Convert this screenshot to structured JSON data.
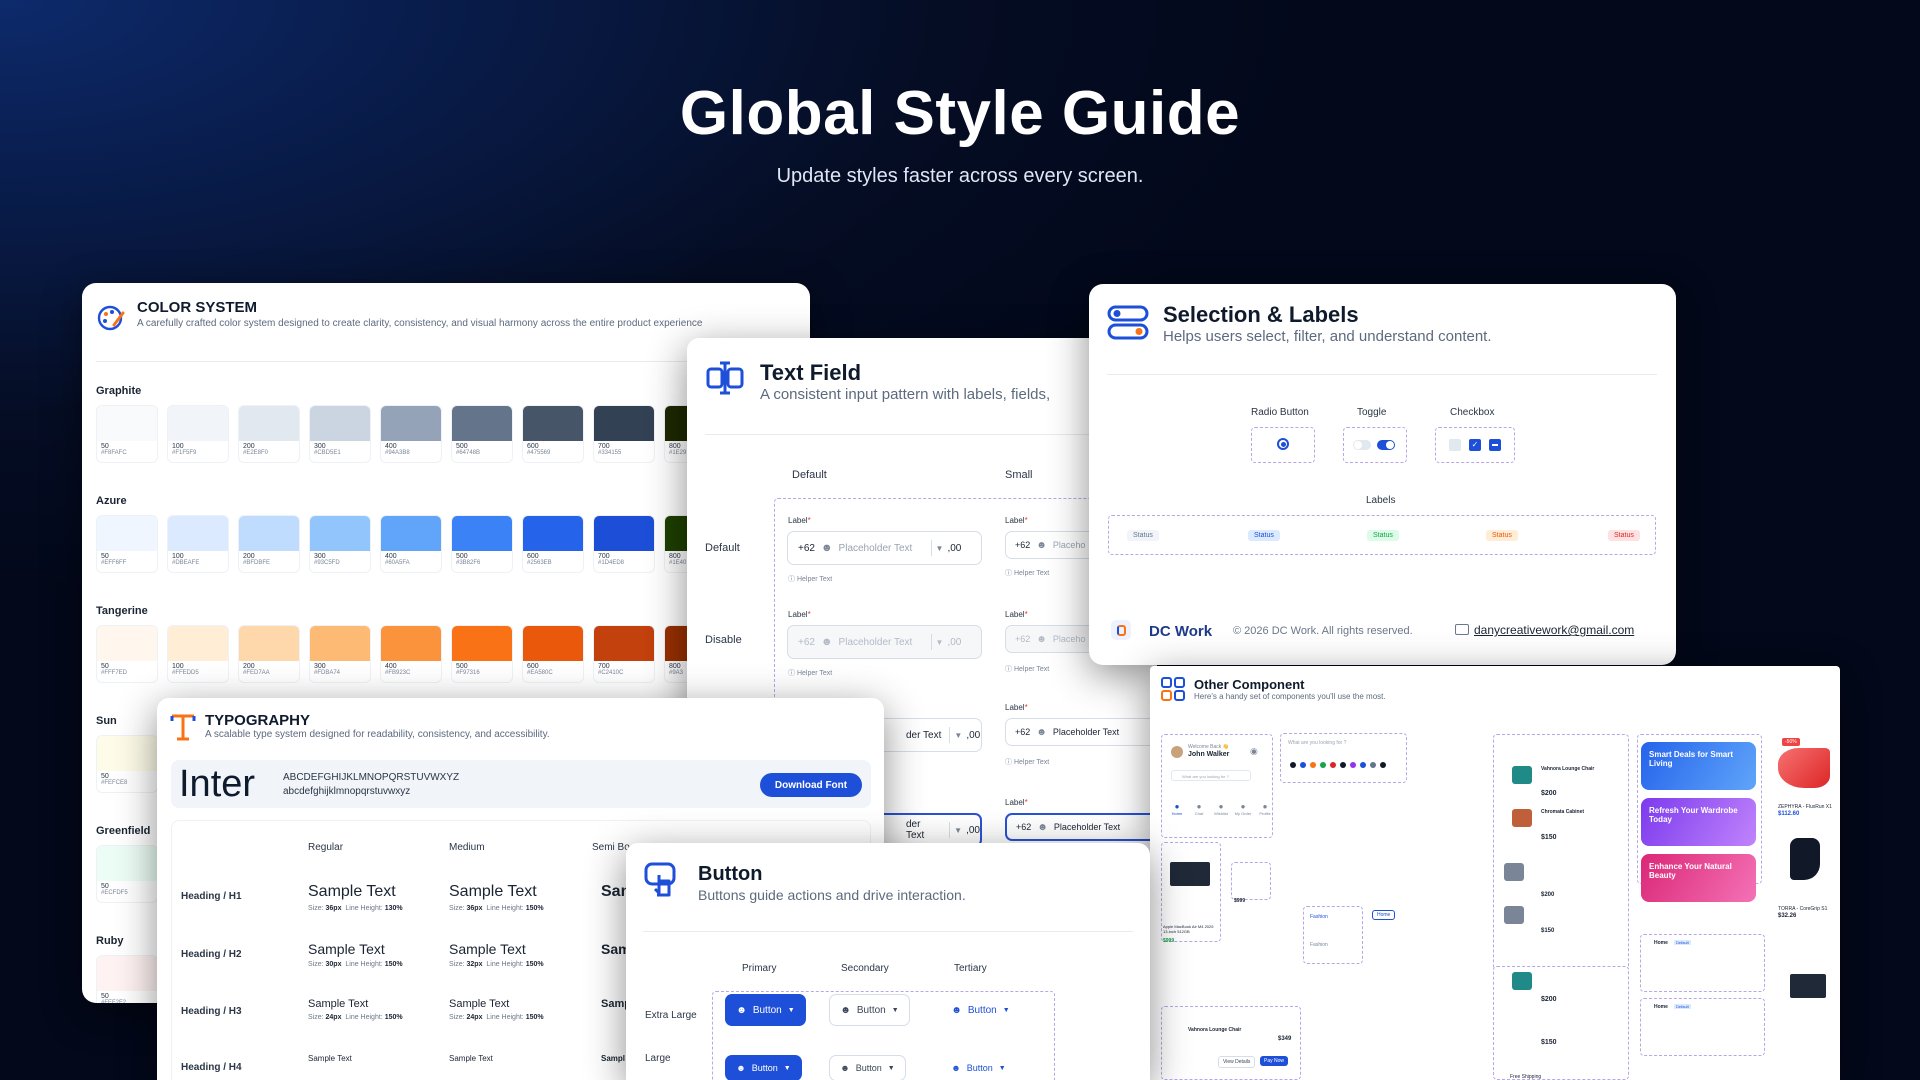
{
  "hero": {
    "title": "Global Style Guide",
    "subtitle": "Update styles faster across every screen."
  },
  "color_system": {
    "title": "COLOR SYSTEM",
    "subtitle": "A carefully crafted color system designed to create clarity, consistency, and visual harmony across the entire product experience",
    "palettes": [
      {
        "name": "Graphite",
        "swatches": [
          {
            "step": "50",
            "hex": "#F8FAFC"
          },
          {
            "step": "100",
            "hex": "#F1F5F9"
          },
          {
            "step": "200",
            "hex": "#E2E8F0"
          },
          {
            "step": "300",
            "hex": "#CBD5E1"
          },
          {
            "step": "400",
            "hex": "#94A3B8"
          },
          {
            "step": "500",
            "hex": "#64748B"
          },
          {
            "step": "600",
            "hex": "#475569"
          },
          {
            "step": "700",
            "hex": "#334155"
          },
          {
            "step": "800",
            "hex": "#1E29"
          }
        ]
      },
      {
        "name": "Azure",
        "swatches": [
          {
            "step": "50",
            "hex": "#EFF6FF"
          },
          {
            "step": "100",
            "hex": "#DBEAFE"
          },
          {
            "step": "200",
            "hex": "#BFDBFE"
          },
          {
            "step": "300",
            "hex": "#93C5FD"
          },
          {
            "step": "400",
            "hex": "#60A5FA"
          },
          {
            "step": "500",
            "hex": "#3B82F6"
          },
          {
            "step": "600",
            "hex": "#2563EB"
          },
          {
            "step": "700",
            "hex": "#1D4ED8"
          },
          {
            "step": "800",
            "hex": "#1E40"
          }
        ]
      },
      {
        "name": "Tangerine",
        "swatches": [
          {
            "step": "50",
            "hex": "#FFF7ED"
          },
          {
            "step": "100",
            "hex": "#FFEDD5"
          },
          {
            "step": "200",
            "hex": "#FED7AA"
          },
          {
            "step": "300",
            "hex": "#FDBA74"
          },
          {
            "step": "400",
            "hex": "#FB923C"
          },
          {
            "step": "500",
            "hex": "#F97316"
          },
          {
            "step": "600",
            "hex": "#EA580C"
          },
          {
            "step": "700",
            "hex": "#C2410C"
          },
          {
            "step": "800",
            "hex": "#9A3"
          }
        ]
      },
      {
        "name": "Sun",
        "swatches": [
          {
            "step": "50",
            "hex": "#FEFCE8"
          }
        ]
      },
      {
        "name": "Greenfield",
        "swatches": [
          {
            "step": "50",
            "hex": "#ECFDF5"
          }
        ]
      },
      {
        "name": "Ruby",
        "swatches": [
          {
            "step": "50",
            "hex": "#FEF2F2"
          }
        ]
      }
    ]
  },
  "text_field": {
    "title": "Text Field",
    "subtitle": "A consistent input pattern with labels, fields,",
    "col_default": "Default",
    "col_small": "Small",
    "row_default": "Default",
    "row_disable": "Disable",
    "label": "Label",
    "required": "*",
    "prefix": "+62",
    "placeholder": "Placeholder Text",
    "placeholder_short": "Placeho",
    "suffix": ",00",
    "helper": "Helper Text",
    "partial_placeholder": "der Text"
  },
  "selection": {
    "title": "Selection & Labels",
    "subtitle": "Helps users select, filter, and understand content.",
    "radio": "Radio Button",
    "toggle": "Toggle",
    "checkbox": "Checkbox",
    "labels_title": "Labels",
    "statuses": [
      {
        "text": "Status",
        "bg": "#f1f5f9",
        "fg": "#64748b"
      },
      {
        "text": "Status",
        "bg": "#dbeafe",
        "fg": "#1d4ed8"
      },
      {
        "text": "Status",
        "bg": "#dcfce7",
        "fg": "#16a34a"
      },
      {
        "text": "Status",
        "bg": "#ffedd5",
        "fg": "#ea580c"
      },
      {
        "text": "Status",
        "bg": "#fee2e2",
        "fg": "#dc2626"
      }
    ],
    "brand": "DC Work",
    "copyright": "© 2026 DC Work. All rights reserved.",
    "email": "danycreativework@gmail.com"
  },
  "typography": {
    "title": "TYPOGRAPHY",
    "subtitle": "A scalable type system designed for readability, consistency, and accessibility.",
    "font_name": "Inter",
    "upper": "ABCDEFGHIJKLMNOPQRSTUVWXYZ",
    "lower": "abcdefghijklmnopqrstuvwxyz",
    "download": "Download Font",
    "col_regular": "Regular",
    "col_medium": "Medium",
    "col_semibold": "Semi Bo",
    "sample": "Sample Text",
    "sample_cut": "San",
    "sample_cut2": "Sam",
    "sample_cut3": "Samp",
    "sample_cut4": "Sampl",
    "size_label": "Size:",
    "lh_label": "Line Height:",
    "rows": [
      {
        "name": "Heading / H1",
        "reg_size": "36px",
        "reg_lh": "130%",
        "med_size": "36px",
        "med_lh": "150%"
      },
      {
        "name": "Heading / H2",
        "reg_size": "30px",
        "reg_lh": "150%",
        "med_size": "32px",
        "med_lh": "150%"
      },
      {
        "name": "Heading / H3",
        "reg_size": "24px",
        "reg_lh": "150%",
        "med_size": "24px",
        "med_lh": "150%"
      },
      {
        "name": "Heading / H4",
        "reg_size": "",
        "reg_lh": "",
        "med_size": "",
        "med_lh": ""
      }
    ]
  },
  "button": {
    "title": "Button",
    "subtitle": "Buttons guide actions and drive interaction.",
    "col_primary": "Primary",
    "col_secondary": "Secondary",
    "col_tertiary": "Tertiary",
    "row_xl": "Extra Large",
    "row_l": "Large",
    "label": "Button"
  },
  "other": {
    "title": "Other Component",
    "subtitle": "Here's a handy set of components you'll use the most.",
    "welcome": "Welcome Back 👋",
    "user": "John Walker",
    "search_ph": "What are you looking for ?",
    "nav": [
      "Home",
      "Chat",
      "Wishlist",
      "My Order",
      "Profile"
    ],
    "product": "Apple MacBook Air M4 2025 13-inch 512GB",
    "price1": "$999",
    "price2": "$200",
    "price3": "$150",
    "price4": "$349",
    "price5": "$112.60",
    "price6": "$32.26",
    "chair": "Vahnora Lounge Chair",
    "cabinet": "Chromata Cabinet",
    "fashion": "Fashion",
    "home_tab": "Home",
    "promo1": "Smart Deals for Smart Living",
    "promo2": "Refresh Your Wardrobe Today",
    "promo3": "Enhance Your Natural Beauty",
    "shoe": "ZEPHYRA - FluxRun X1",
    "sock": "TORRA - CoreGrip S1",
    "pay": "Pay Now",
    "details": "View Details",
    "badge_sale": "-50%",
    "free_ship": "Free Shipping",
    "address_home": "Home",
    "default_tag": "Default"
  }
}
